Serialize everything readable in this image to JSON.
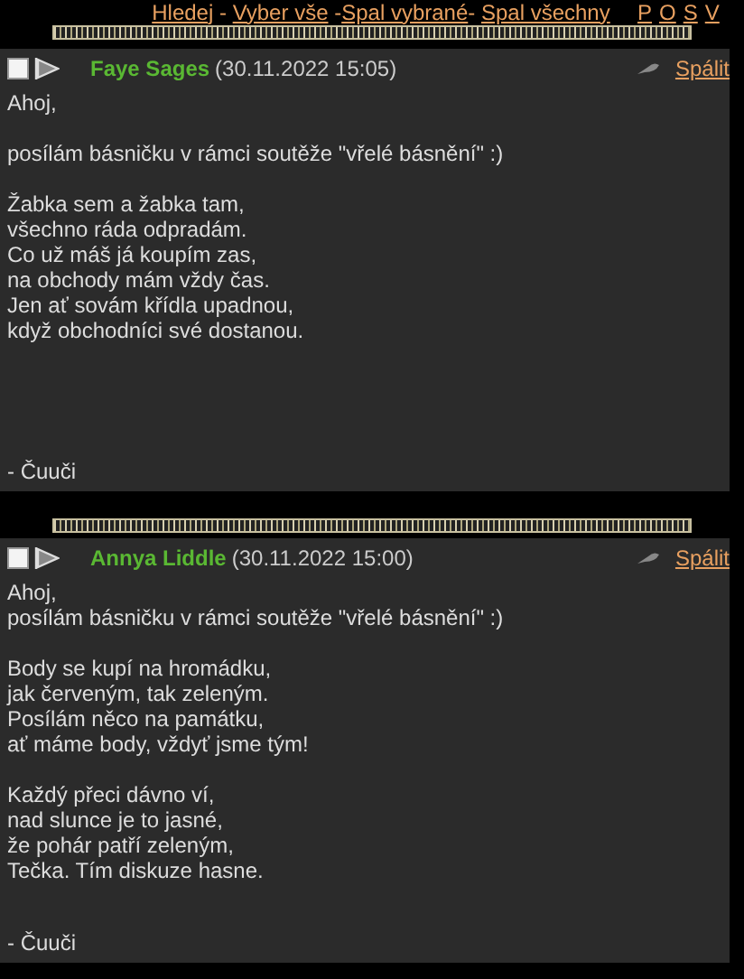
{
  "nav": {
    "items": [
      {
        "kind": "link",
        "text": "Hledej"
      },
      {
        "kind": "sep",
        "text": " - "
      },
      {
        "kind": "link",
        "text": "Vyber vše"
      },
      {
        "kind": "sep",
        "text": " -"
      },
      {
        "kind": "link",
        "text": "Spal vybrané"
      },
      {
        "kind": "sep",
        "text": "- "
      },
      {
        "kind": "link",
        "text": "Spal všechny"
      }
    ],
    "letters": [
      "P",
      "O",
      "S",
      "V"
    ]
  },
  "posts": [
    {
      "checked": false,
      "author": "Faye Sages",
      "date": "(30.11.2022 15:05)",
      "action": "Spálit",
      "blocks": [
        [
          "Ahoj,"
        ],
        [
          "posílám básničku v rámci soutěže \"vřelé básnění\" :)"
        ],
        [
          "Žabka sem a žabka tam,",
          "všechno ráda odpradám.",
          "Co už máš já koupím zas,",
          "na obchody mám vždy čas.",
          "Jen ať sovám křídla upadnou,",
          "když obchodníci své dostanou."
        ]
      ],
      "signature": "- Čuuči"
    },
    {
      "checked": false,
      "author": "Annya Liddle",
      "date": "(30.11.2022 15:00)",
      "action": "Spálit",
      "blocks": [
        [
          "Ahoj,",
          "posílám básničku v rámci soutěže \"vřelé básnění\" :)"
        ],
        [
          "Body se kupí na hromádku,",
          "jak červeným, tak zeleným.",
          "Posílám něco na památku,",
          "ať máme body, vždyť jsme tým!"
        ],
        [
          "Každý přeci dávno ví,",
          "nad slunce je to jasné,",
          "že pohár patří zeleným,",
          "Tečka. Tím diskuze hasne."
        ]
      ],
      "signature": "- Čuuči"
    }
  ]
}
